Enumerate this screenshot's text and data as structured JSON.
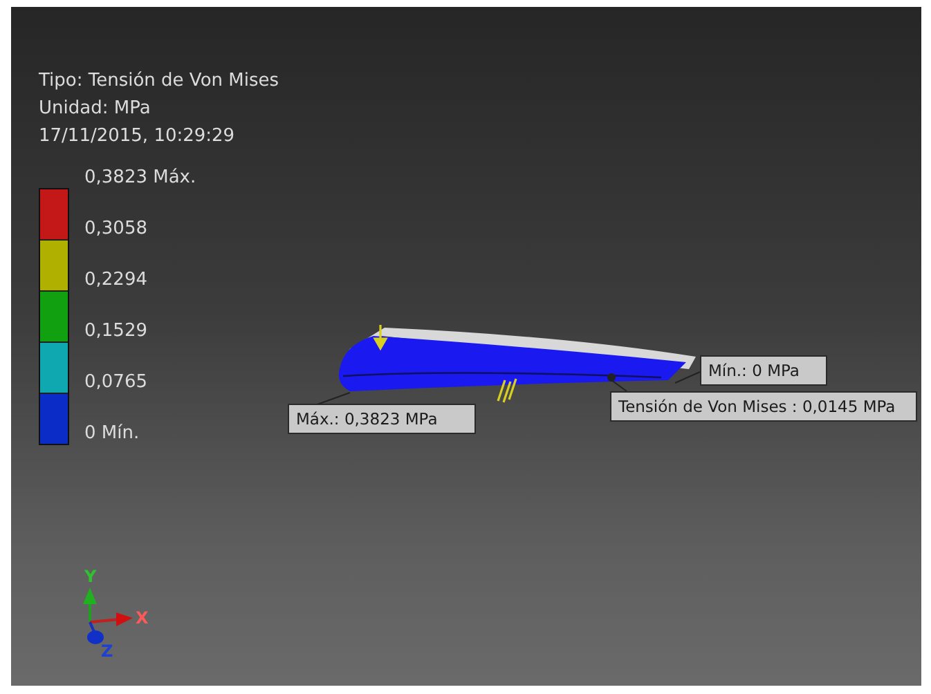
{
  "legend": {
    "type": "Tipo: Tensión de Von Mises",
    "unit": "Unidad: MPa",
    "timestamp": "17/11/2015, 10:29:29",
    "labels": [
      "0,3823 Máx.",
      "0,3058",
      "0,2294",
      "0,1529",
      "0,0765",
      "0 Mín."
    ],
    "bands": [
      {
        "color": "#c41818"
      },
      {
        "color": "#b0b000"
      },
      {
        "color": "#10a010"
      },
      {
        "color": "#10a8b0"
      },
      {
        "color": "#0c2cc8"
      }
    ]
  },
  "callouts": [
    {
      "kind": "max",
      "text": "Máx.: 0,3823 MPa"
    },
    {
      "kind": "min",
      "text": "Mín.: 0 MPa"
    },
    {
      "kind": "probe",
      "text": "Tensión de Von Mises : 0,0145 MPa"
    }
  ],
  "axes": {
    "x": "X",
    "y": "Y",
    "z": "Z"
  }
}
